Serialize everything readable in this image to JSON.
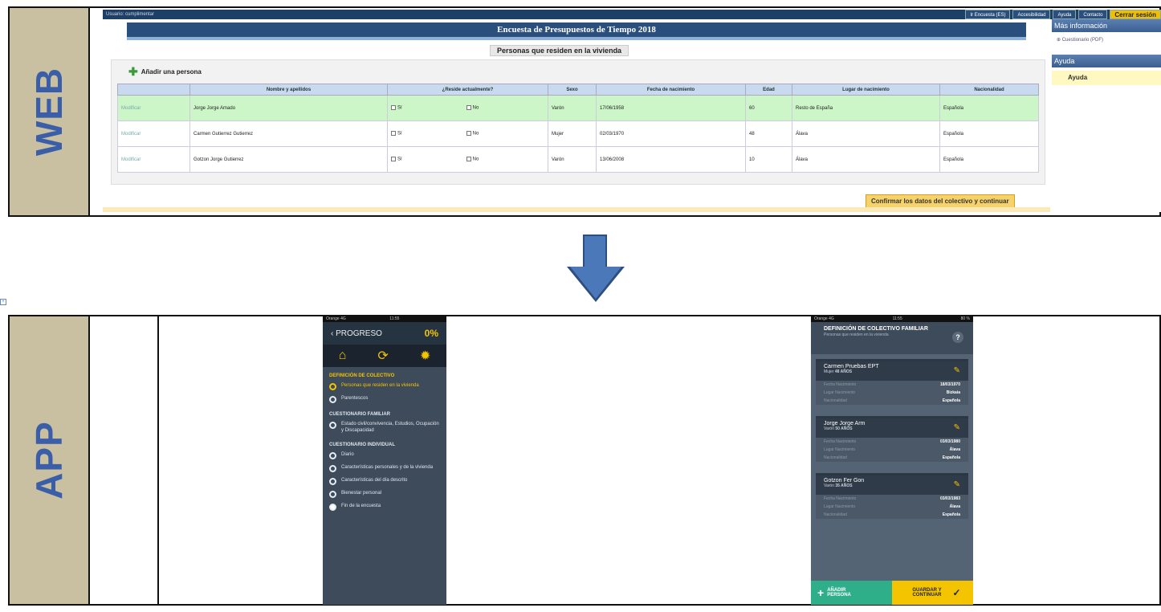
{
  "labels": {
    "web": "WEB",
    "app": "APP"
  },
  "web": {
    "topbar_user": "Usuario: cumplimentar",
    "topbar_buttons": [
      "Ir Encuesta (ES)",
      "Accesibilidad",
      "Ayuda",
      "Contacto",
      "Cerrar sesión"
    ],
    "header_title": "Encuesta de Presupuestos de Tiempo 2018",
    "page_title": "Personas que residen en la vivienda",
    "add_person": "Añadir una persona",
    "columns": [
      "",
      "Nombre y apellidos",
      "¿Reside actualmente?",
      "Sexo",
      "Fecha de nacimiento",
      "Edad",
      "Lugar de nacimiento",
      "Nacionalidad"
    ],
    "rows": [
      {
        "action": "Modificar",
        "name": "Jorge Jorge Amado",
        "yes": "Sí",
        "no": "No",
        "sex": "Varón",
        "dob": "17/06/1958",
        "age": "60",
        "birthplace": "Resto de España",
        "nationality": "Española"
      },
      {
        "action": "Modificar",
        "name": "Carmen Gutierrez Gutierrez",
        "yes": "Sí",
        "no": "No",
        "sex": "Mujer",
        "dob": "02/03/1970",
        "age": "48",
        "birthplace": "Álava",
        "nationality": "Española"
      },
      {
        "action": "Modificar",
        "name": "Gotzon Jorge Gutierrez",
        "yes": "Sí",
        "no": "No",
        "sex": "Varón",
        "dob": "13/06/2008",
        "age": "10",
        "birthplace": "Álava",
        "nationality": "Española"
      }
    ],
    "confirm_button": "Confirmar los datos del colectivo y continuar",
    "sidebar": {
      "more_info": "Más información",
      "questionnaire": "Cuestionario (PDF)",
      "help_head": "Ayuda",
      "help_link": "Ayuda"
    }
  },
  "app1": {
    "status_left": "Orange 4G",
    "status_time": "11:55",
    "back_label": "PROGRESO",
    "progress": "0%",
    "sections": [
      {
        "title": "DEFINICIÓN DE COLECTIVO",
        "steps": [
          "Personas que residen en la vivienda",
          "Parentescos"
        ]
      },
      {
        "title": "CUESTIONARIO FAMILIAR",
        "steps": [
          "Estado civil/convivencia, Estudios, Ocupación y Discapacidad"
        ]
      },
      {
        "title": "CUESTIONARIO INDIVIDUAL",
        "steps": [
          "Diario",
          "Características personales y de la vivienda",
          "Características del día descrito",
          "Bienestar personal",
          "Fin de la encuesta"
        ]
      }
    ]
  },
  "app2": {
    "status_left": "Orange 4G",
    "status_time": "11:55",
    "status_right": "80 %",
    "title": "DEFINICIÓN DE COLECTIVO FAMILIAR",
    "subtitle": "Personas que residen en la vivienda",
    "help": "?",
    "field_labels": {
      "dob": "Fecha Nacimiento",
      "place": "Lugar Nacimiento",
      "nat": "Nacionalidad"
    },
    "cards": [
      {
        "name": "Carmen Pruebas EPT",
        "sub_sex": "Mujer",
        "sub_age": "48 AÑOS",
        "dob": "18/03/1970",
        "place": "Bizkaia",
        "nat": "Española"
      },
      {
        "name": "Jorge Jorge Arm",
        "sub_sex": "Varón",
        "sub_age": "50 AÑOS",
        "dob": "03/03/1980",
        "place": "Álava",
        "nat": "Española"
      },
      {
        "name": "Gotzon Fer Gon",
        "sub_sex": "Varón",
        "sub_age": "35 AÑOS",
        "dob": "03/03/1983",
        "place": "Álava",
        "nat": "Española"
      }
    ],
    "add_button": "AÑADIR PERSONA",
    "save_button": "GUARDAR Y CONTINUAR"
  }
}
